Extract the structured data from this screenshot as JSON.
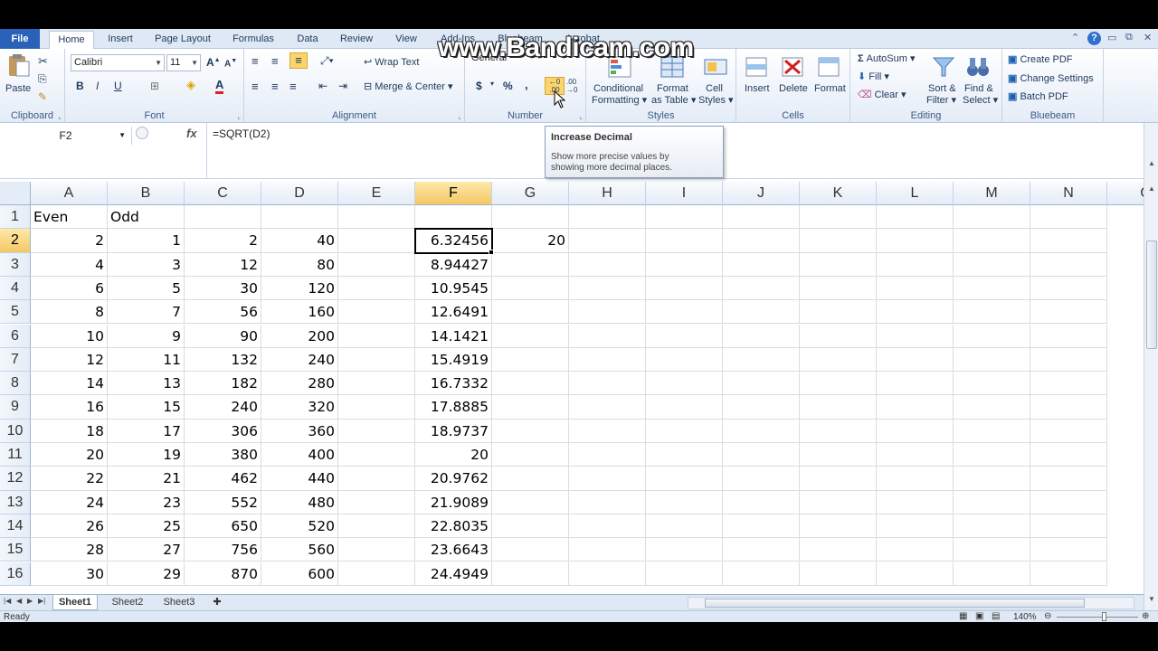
{
  "watermark": "www.Bandicam.com",
  "tabs": [
    "File",
    "Home",
    "Insert",
    "Page Layout",
    "Formulas",
    "Data",
    "Review",
    "View",
    "Add-Ins",
    "Bluebeam",
    "Acrobat"
  ],
  "ribbon": {
    "clipboard": {
      "paste": "Paste",
      "label": "Clipboard"
    },
    "font": {
      "name": "Calibri",
      "size": "11",
      "label": "Font",
      "bold": "B",
      "italic": "I",
      "underline": "U"
    },
    "alignment": {
      "wrap_text": "Wrap Text",
      "merge_center": "Merge & Center",
      "label": "Alignment"
    },
    "number": {
      "format": "General",
      "currency": "$",
      "percent": "%",
      "comma": ",",
      "label": "Number"
    },
    "styles": {
      "conditional": "Conditional",
      "conditional2": "Formatting",
      "format_as": "Format",
      "format_as2": "as Table",
      "cell": "Cell",
      "cell2": "Styles",
      "label": "Styles"
    },
    "cells": {
      "insert": "Insert",
      "delete": "Delete",
      "format": "Format",
      "label": "Cells"
    },
    "editing": {
      "autosum": "AutoSum",
      "fill": "Fill",
      "clear": "Clear",
      "sort": "Sort &",
      "sort2": "Filter",
      "find": "Find &",
      "find2": "Select",
      "label": "Editing"
    },
    "bluebeam": {
      "create_pdf": "Create PDF",
      "change_settings": "Change Settings",
      "batch_pdf": "Batch PDF",
      "label": "Bluebeam"
    }
  },
  "formula_bar": {
    "name_box": "F2",
    "fx": "fx",
    "formula": "=SQRT(D2)"
  },
  "tooltip": {
    "title": "Increase Decimal",
    "body1": "Show more precise values by",
    "body2": "showing more decimal places."
  },
  "columns": [
    "A",
    "B",
    "C",
    "D",
    "E",
    "F",
    "G",
    "H",
    "I",
    "J",
    "K",
    "L",
    "M",
    "N",
    "C"
  ],
  "rows": [
    {
      "n": "1",
      "A": "Even",
      "B": "Odd",
      "C": "",
      "D": "",
      "F": "",
      "G": ""
    },
    {
      "n": "2",
      "A": "2",
      "B": "1",
      "C": "2",
      "D": "40",
      "F": "6.32456",
      "G": "20"
    },
    {
      "n": "3",
      "A": "4",
      "B": "3",
      "C": "12",
      "D": "80",
      "F": "8.94427",
      "G": ""
    },
    {
      "n": "4",
      "A": "6",
      "B": "5",
      "C": "30",
      "D": "120",
      "F": "10.9545",
      "G": ""
    },
    {
      "n": "5",
      "A": "8",
      "B": "7",
      "C": "56",
      "D": "160",
      "F": "12.6491",
      "G": ""
    },
    {
      "n": "6",
      "A": "10",
      "B": "9",
      "C": "90",
      "D": "200",
      "F": "14.1421",
      "G": ""
    },
    {
      "n": "7",
      "A": "12",
      "B": "11",
      "C": "132",
      "D": "240",
      "F": "15.4919",
      "G": ""
    },
    {
      "n": "8",
      "A": "14",
      "B": "13",
      "C": "182",
      "D": "280",
      "F": "16.7332",
      "G": ""
    },
    {
      "n": "9",
      "A": "16",
      "B": "15",
      "C": "240",
      "D": "320",
      "F": "17.8885",
      "G": ""
    },
    {
      "n": "10",
      "A": "18",
      "B": "17",
      "C": "306",
      "D": "360",
      "F": "18.9737",
      "G": ""
    },
    {
      "n": "11",
      "A": "20",
      "B": "19",
      "C": "380",
      "D": "400",
      "F": "20",
      "G": ""
    },
    {
      "n": "12",
      "A": "22",
      "B": "21",
      "C": "462",
      "D": "440",
      "F": "20.9762",
      "G": ""
    },
    {
      "n": "13",
      "A": "24",
      "B": "23",
      "C": "552",
      "D": "480",
      "F": "21.9089",
      "G": ""
    },
    {
      "n": "14",
      "A": "26",
      "B": "25",
      "C": "650",
      "D": "520",
      "F": "22.8035",
      "G": ""
    },
    {
      "n": "15",
      "A": "28",
      "B": "27",
      "C": "756",
      "D": "560",
      "F": "23.6643",
      "G": ""
    },
    {
      "n": "16",
      "A": "30",
      "B": "29",
      "C": "870",
      "D": "600",
      "F": "24.4949",
      "G": ""
    }
  ],
  "selected_cell": "F2",
  "sheets": [
    "Sheet1",
    "Sheet2",
    "Sheet3"
  ],
  "status": {
    "ready": "Ready",
    "zoom": "140%"
  },
  "colors": {
    "selection_header": "#f5c765",
    "ribbon_bg": "#dfe9f5",
    "file_tab": "#2a62b8"
  }
}
